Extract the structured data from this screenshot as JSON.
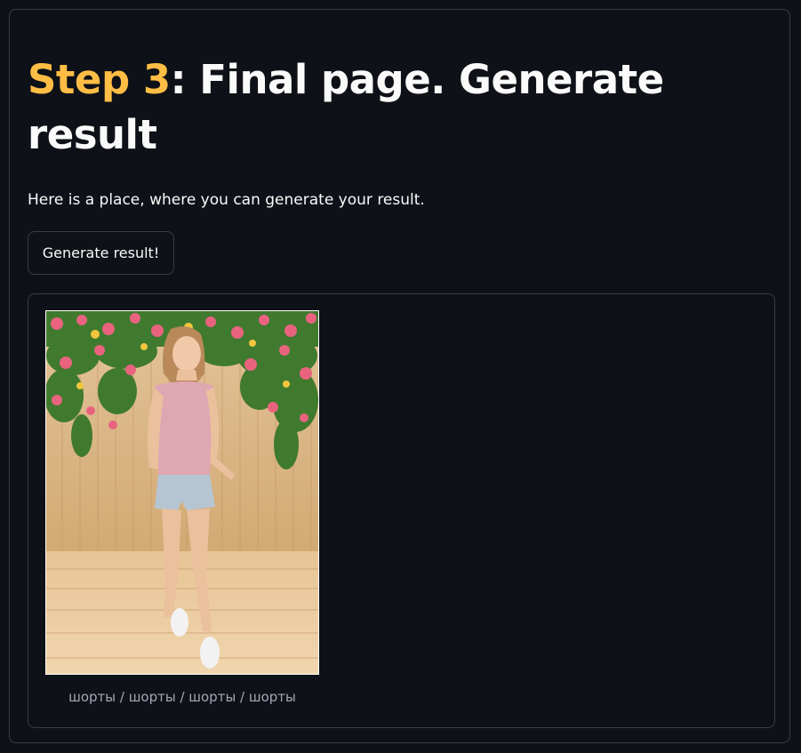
{
  "page": {
    "title_accent": "Step 3",
    "title_rest": ": Final page. Generate result",
    "subtitle": "Here is a place, where you can generate your result.",
    "generate_button": "Generate result!"
  },
  "result": {
    "image_caption": "шорты / шорты / шорты / шорты"
  },
  "colors": {
    "background": "#0e1117",
    "accent": "#ffbd45",
    "text": "#fafafa",
    "border": "#3a3d45"
  }
}
